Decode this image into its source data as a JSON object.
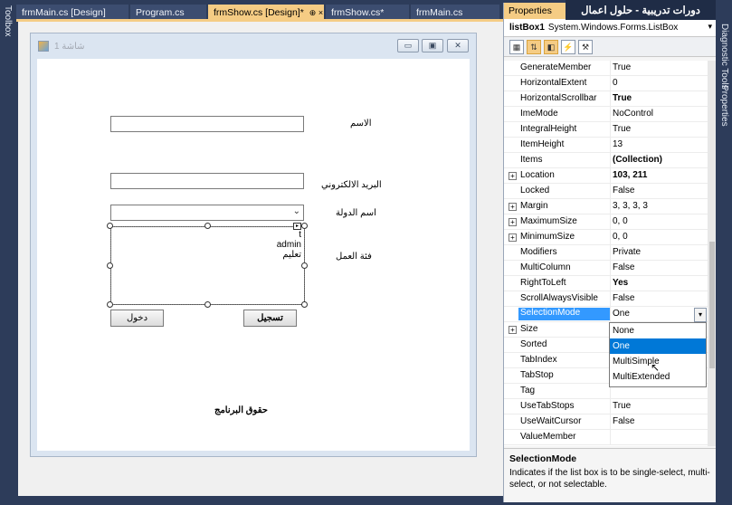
{
  "tabs": [
    {
      "label": "frmMain.cs [Design]",
      "active": false
    },
    {
      "label": "Program.cs",
      "active": false
    },
    {
      "label": "frmShow.cs [Design]*",
      "active": true,
      "ctl": "⊕ ×"
    },
    {
      "label": "frmShow.cs*",
      "active": false
    },
    {
      "label": "frmMain.cs",
      "active": false
    }
  ],
  "side": {
    "toolbox": "Toolbox",
    "diagnostic": "Diagnostic Tools",
    "properties": "Properties"
  },
  "form": {
    "title": "شاشة 1",
    "name_label": "الاسم",
    "email_label": "البريد الالكتروني",
    "country_label": "اسم الدولة",
    "category_label": "فئة العمل",
    "list_items": [
      "t",
      "admin",
      "تعليم"
    ],
    "login_button": "دخول",
    "register_button": "تسجيل",
    "rights_label": "حقوق البرنامج"
  },
  "overlay": {
    "title": "دورات تدريبية - حلول اعمال"
  },
  "properties": {
    "panel_title": "Properties",
    "object_name": "listBox1",
    "object_type": "System.Windows.Forms.ListBox",
    "rows": [
      {
        "name": "GenerateMember",
        "value": "True",
        "expand": false,
        "bold": false
      },
      {
        "name": "HorizontalExtent",
        "value": "0",
        "expand": false,
        "bold": false
      },
      {
        "name": "HorizontalScrollbar",
        "value": "True",
        "expand": false,
        "bold": true
      },
      {
        "name": "ImeMode",
        "value": "NoControl",
        "expand": false,
        "bold": false
      },
      {
        "name": "IntegralHeight",
        "value": "True",
        "expand": false,
        "bold": false
      },
      {
        "name": "ItemHeight",
        "value": "13",
        "expand": false,
        "bold": false
      },
      {
        "name": "Items",
        "value": "(Collection)",
        "expand": false,
        "bold": true
      },
      {
        "name": "Location",
        "value": "103, 211",
        "expand": true,
        "bold": true
      },
      {
        "name": "Locked",
        "value": "False",
        "expand": false,
        "bold": false
      },
      {
        "name": "Margin",
        "value": "3, 3, 3, 3",
        "expand": true,
        "bold": false
      },
      {
        "name": "MaximumSize",
        "value": "0, 0",
        "expand": true,
        "bold": false
      },
      {
        "name": "MinimumSize",
        "value": "0, 0",
        "expand": true,
        "bold": false
      },
      {
        "name": "Modifiers",
        "value": "Private",
        "expand": false,
        "bold": false
      },
      {
        "name": "MultiColumn",
        "value": "False",
        "expand": false,
        "bold": false
      },
      {
        "name": "RightToLeft",
        "value": "Yes",
        "expand": false,
        "bold": true
      },
      {
        "name": "ScrollAlwaysVisible",
        "value": "False",
        "expand": false,
        "bold": false
      },
      {
        "name": "SelectionMode",
        "value": "One",
        "expand": false,
        "bold": false,
        "selected": true
      },
      {
        "name": "Size",
        "value": "",
        "expand": true,
        "bold": false
      },
      {
        "name": "Sorted",
        "value": "",
        "expand": false,
        "bold": false
      },
      {
        "name": "TabIndex",
        "value": "",
        "expand": false,
        "bold": false
      },
      {
        "name": "TabStop",
        "value": "",
        "expand": false,
        "bold": false
      },
      {
        "name": "Tag",
        "value": "",
        "expand": false,
        "bold": false
      },
      {
        "name": "UseTabStops",
        "value": "True",
        "expand": false,
        "bold": false
      },
      {
        "name": "UseWaitCursor",
        "value": "False",
        "expand": false,
        "bold": false
      },
      {
        "name": "ValueMember",
        "value": "",
        "expand": false,
        "bold": false
      }
    ],
    "dropdown_options": [
      "None",
      "One",
      "MultiSimple",
      "MultiExtended"
    ],
    "dropdown_selected": "One",
    "description_title": "SelectionMode",
    "description_text": "Indicates if the list box is to be single-select, multi-select, or not selectable."
  }
}
